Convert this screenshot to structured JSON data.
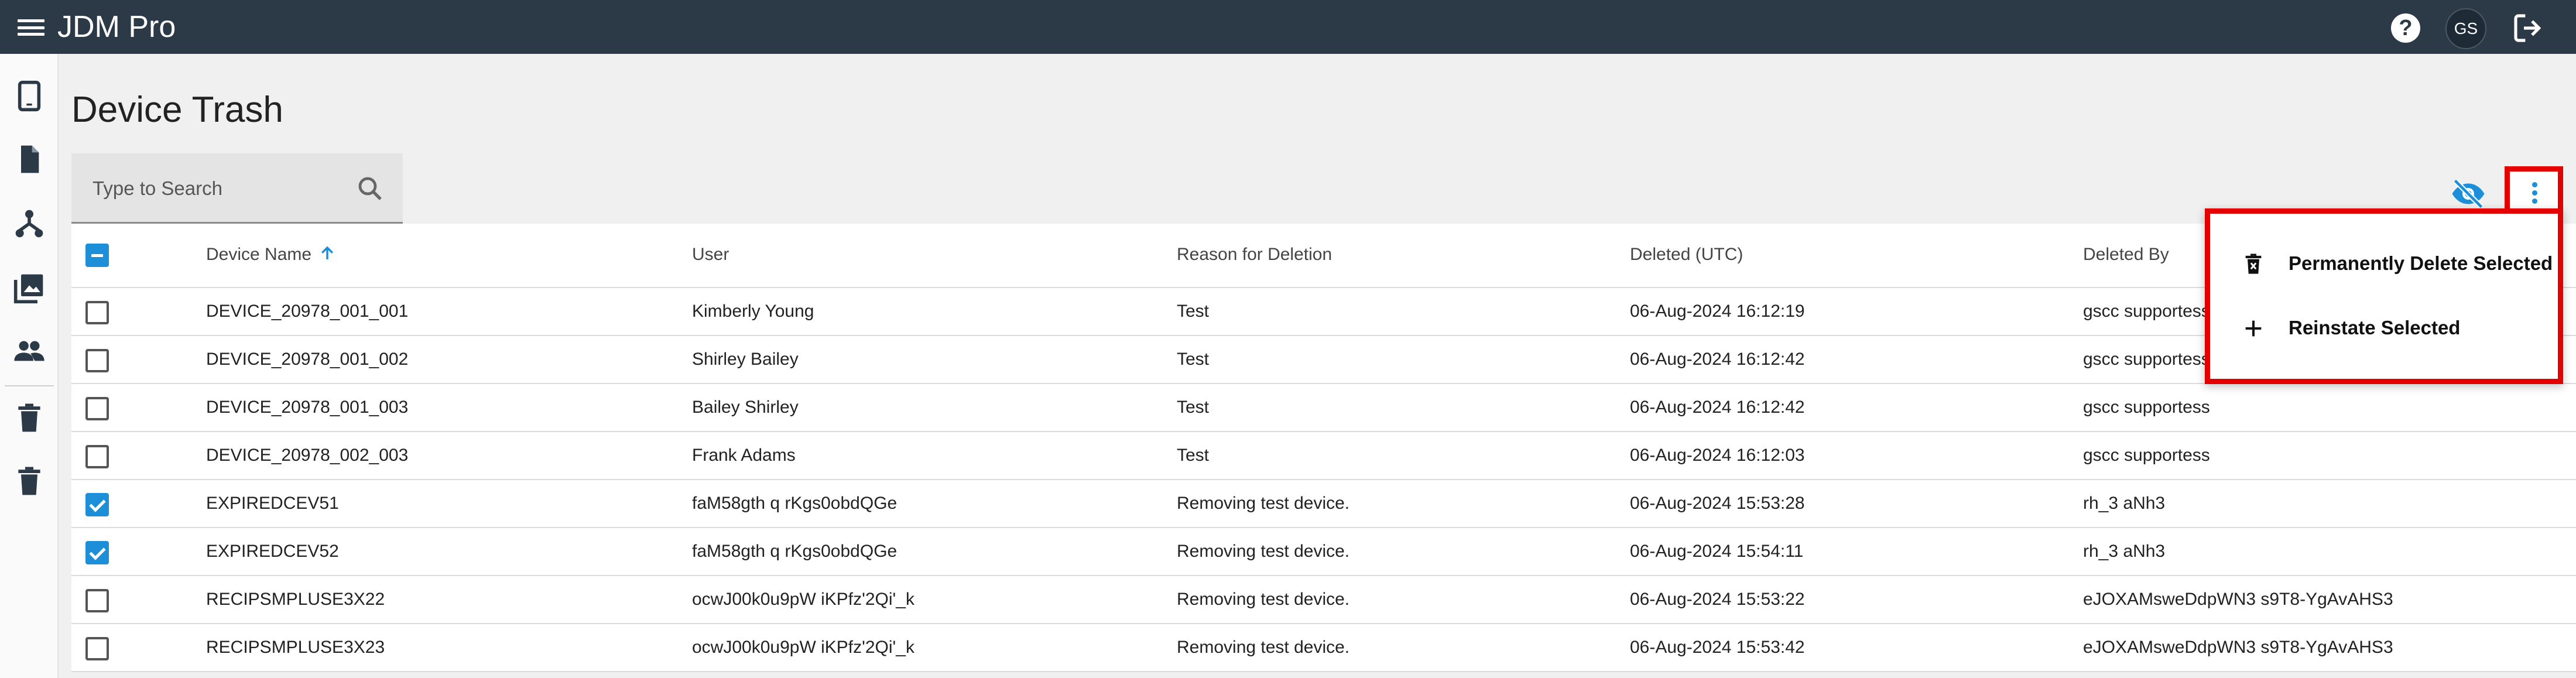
{
  "header": {
    "app_title": "JDM Pro",
    "help_icon": "help-circle-icon",
    "avatar_initials": "GS",
    "logout_icon": "logout-icon"
  },
  "sidebar": {
    "items": [
      {
        "icon": "tablet-icon"
      },
      {
        "icon": "document-icon"
      },
      {
        "icon": "hierarchy-icon"
      },
      {
        "icon": "image-library-icon"
      },
      {
        "icon": "people-icon"
      },
      {
        "icon": "trash-icon"
      },
      {
        "icon": "trash-icon"
      }
    ]
  },
  "page": {
    "title": "Device Trash"
  },
  "search": {
    "placeholder": "Type to Search",
    "value": ""
  },
  "table": {
    "headers": {
      "device_name": "Device Name",
      "user": "User",
      "reason": "Reason for Deletion",
      "deleted": "Deleted (UTC)",
      "deleted_by": "Deleted By"
    },
    "rows": [
      {
        "device": "DEVICE_20978_001_001",
        "user": "Kimberly Young",
        "reason": "Test",
        "deleted": "06-Aug-2024 16:12:19",
        "by": "gscc supportess",
        "checked": false
      },
      {
        "device": "DEVICE_20978_001_002",
        "user": "Shirley Bailey",
        "reason": "Test",
        "deleted": "06-Aug-2024 16:12:42",
        "by": "gscc supportess",
        "checked": false
      },
      {
        "device": "DEVICE_20978_001_003",
        "user": "Bailey Shirley",
        "reason": "Test",
        "deleted": "06-Aug-2024 16:12:42",
        "by": "gscc supportess",
        "checked": false
      },
      {
        "device": "DEVICE_20978_002_003",
        "user": "Frank Adams",
        "reason": "Test",
        "deleted": "06-Aug-2024 16:12:03",
        "by": "gscc supportess",
        "checked": false
      },
      {
        "device": "EXPIREDCEV51",
        "user": "faM58gth q rKgs0obdQGe",
        "reason": "Removing test device.",
        "deleted": "06-Aug-2024 15:53:28",
        "by": "rh_3 aNh3",
        "checked": true
      },
      {
        "device": "EXPIREDCEV52",
        "user": "faM58gth q rKgs0obdQGe",
        "reason": "Removing test device.",
        "deleted": "06-Aug-2024 15:54:11",
        "by": "rh_3 aNh3",
        "checked": true
      },
      {
        "device": "RECIPSMPLUSE3X22",
        "user": "ocwJ00k0u9pW iKPfz'2Qi'_k",
        "reason": "Removing test device.",
        "deleted": "06-Aug-2024 15:53:22",
        "by": "eJOXAMsweDdpWN3 s9T8-YgAvAHS3",
        "checked": false
      },
      {
        "device": "RECIPSMPLUSE3X23",
        "user": "ocwJ00k0u9pW iKPfz'2Qi'_k",
        "reason": "Removing test device.",
        "deleted": "06-Aug-2024 15:53:42",
        "by": "eJOXAMsweDdpWN3 s9T8-YgAvAHS3",
        "checked": false
      }
    ]
  },
  "menu": {
    "items": [
      {
        "label": "Permanently Delete Selected",
        "icon": "delete-forever-icon"
      },
      {
        "label": "Reinstate Selected",
        "icon": "plus-icon"
      }
    ]
  },
  "colors": {
    "header_bg": "#2c3a48",
    "accent": "#1d8fd8",
    "highlight": "#e50000"
  }
}
